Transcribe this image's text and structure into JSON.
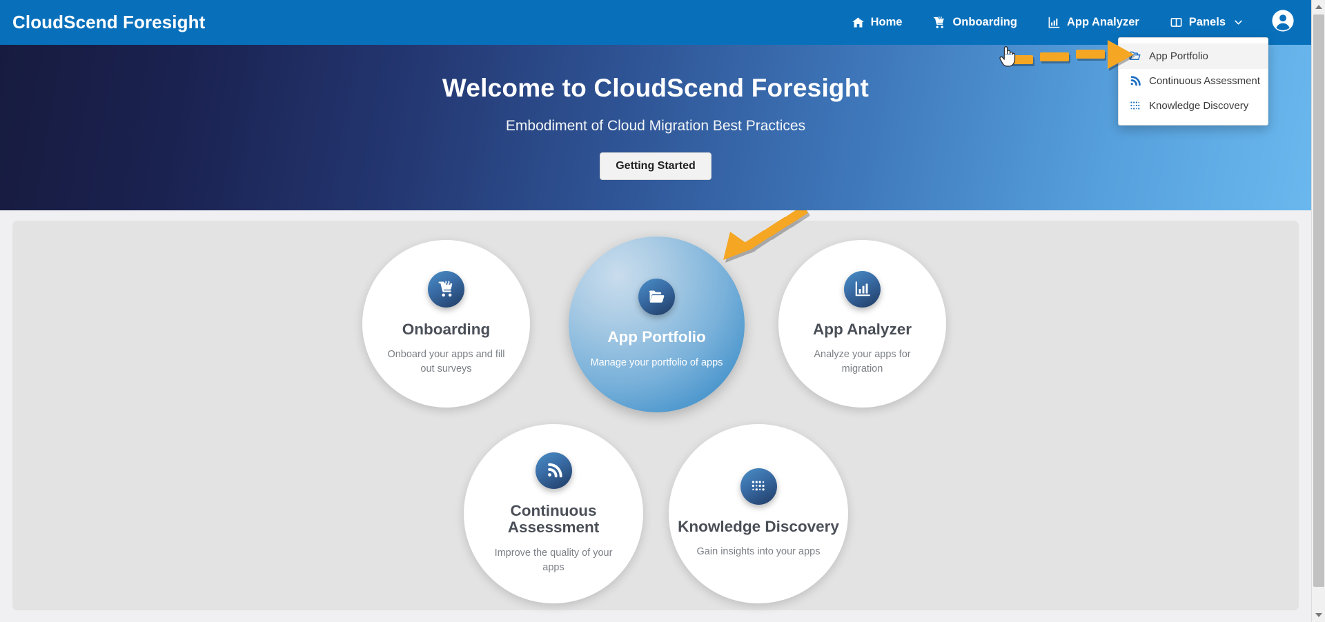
{
  "brand": {
    "title": "CloudScend Foresight"
  },
  "navbar": {
    "items": [
      {
        "label": "Home",
        "icon": "home-icon"
      },
      {
        "label": "Onboarding",
        "icon": "dolly-icon"
      },
      {
        "label": "App Analyzer",
        "icon": "bar-chart-icon"
      },
      {
        "label": "Panels",
        "icon": "panels-icon",
        "caret": "chevron-down-icon"
      }
    ],
    "avatar": "user-avatar-icon",
    "background_color": "#0870bb"
  },
  "dropdown": {
    "open": true,
    "items": [
      {
        "label": "App Portfolio",
        "icon": "open-folder-icon",
        "hovered": true
      },
      {
        "label": "Continuous Assessment",
        "icon": "rss-signal-icon",
        "hovered": false
      },
      {
        "label": "Knowledge Discovery",
        "icon": "dot-grid-icon",
        "hovered": false
      }
    ]
  },
  "hero": {
    "title": "Welcome to CloudScend Foresight",
    "subtitle": "Embodiment of Cloud Migration Best Practices",
    "button_label": "Getting Started"
  },
  "cards": [
    {
      "id": "onboarding",
      "title": "Onboarding",
      "description": "Onboard your apps and fill out surveys",
      "icon": "dolly-icon",
      "active": false
    },
    {
      "id": "app-portfolio",
      "title": "App Portfolio",
      "description": "Manage your portfolio of apps",
      "icon": "open-folder-icon",
      "active": true
    },
    {
      "id": "app-analyzer",
      "title": "App Analyzer",
      "description": "Analyze your apps for migration",
      "icon": "bar-chart-icon",
      "active": false
    },
    {
      "id": "continuous-assessment",
      "title": "Continuous Assessment",
      "description": "Improve the quality of your apps",
      "icon": "rss-signal-icon",
      "active": false
    },
    {
      "id": "knowledge-discovery",
      "title": "Knowledge Discovery",
      "description": "Gain insights into your apps",
      "icon": "dot-grid-icon",
      "active": false
    }
  ],
  "annotations": {
    "arrow_color": "#f5a623",
    "arrows": [
      {
        "name": "arrow-to-dropdown",
        "direction": "right",
        "target": "App Portfolio menu item"
      },
      {
        "name": "arrow-to-circle",
        "direction": "down-left",
        "target": "App Portfolio card"
      }
    ],
    "cursor": "hand-pointer-cursor"
  },
  "scrollbar": {
    "up_arrow": "scroll-up-arrow",
    "down_arrow": "scroll-down-arrow"
  }
}
